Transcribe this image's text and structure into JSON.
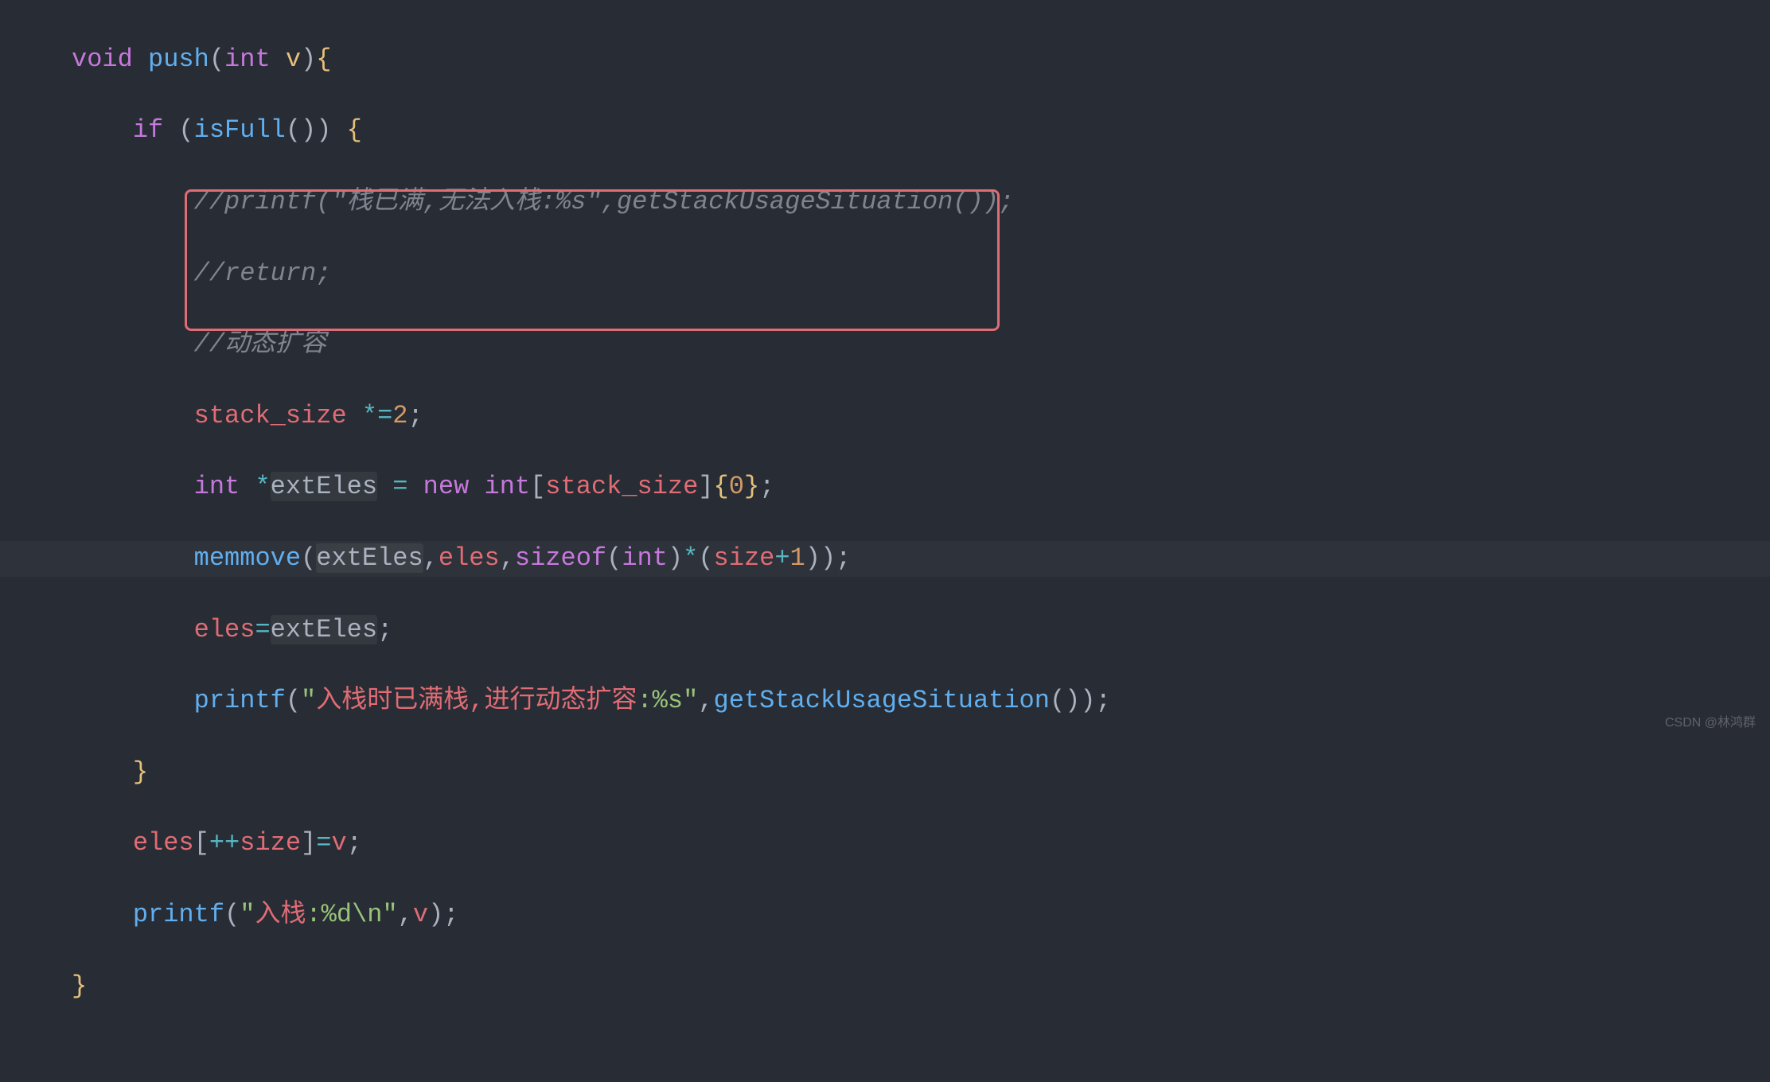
{
  "code": {
    "line1": {
      "kw_void": "void",
      "fn": "push",
      "paren_open": "(",
      "kw_int": "int",
      "param": "v",
      "paren_close": ")",
      "brace": "{"
    },
    "line2": {
      "kw_if": "if",
      "paren_open": "(",
      "fn": "isFull",
      "parens": "()",
      "paren_close": ")",
      "brace": "{"
    },
    "line3": {
      "comment": "//printf(\"栈已满,无法入栈:%s\",getStackUsageSituation());"
    },
    "line4": {
      "comment": "//return;"
    },
    "line5": {
      "comment": "//动态扩容"
    },
    "line6": {
      "ident": "stack_size",
      "op": "*=",
      "num": "2",
      "semi": ";"
    },
    "line7": {
      "kw_int": "int",
      "star": "*",
      "var": "extEles",
      "eq": "=",
      "kw_new": "new",
      "kw_int2": "int",
      "br_open": "[",
      "ident": "stack_size",
      "br_close": "]",
      "brace_open": "{",
      "num": "0",
      "brace_close": "}",
      "semi": ";"
    },
    "line8": {
      "fn": "memmove",
      "paren_open": "(",
      "arg1": "extEles",
      "comma1": ",",
      "arg2": "eles",
      "comma2": ",",
      "kw_sizeof": "sizeof",
      "paren_open2": "(",
      "kw_int": "int",
      "paren_close2": ")",
      "star": "*",
      "paren_open3": "(",
      "ident": "size",
      "plus": "+",
      "num": "1",
      "paren_close3": ")",
      "paren_close": ")",
      "semi": ";"
    },
    "line9": {
      "ident": "eles",
      "eq": "=",
      "var": "extEles",
      "semi": ";"
    },
    "line10": {
      "fn": "printf",
      "paren_open": "(",
      "quote1": "\"",
      "str_cn": "入栈时已满栈,进行动态扩容",
      "str_fmt": ":%s",
      "quote2": "\"",
      "comma": ",",
      "fn2": "getStackUsageSituation",
      "parens": "()",
      "paren_close": ")",
      "semi": ";"
    },
    "line11": {
      "brace": "}"
    },
    "line12": {
      "ident": "eles",
      "br_open": "[",
      "op": "++",
      "ident2": "size",
      "br_close": "]",
      "eq": "=",
      "ident3": "v",
      "semi": ";"
    },
    "line13": {
      "fn": "printf",
      "paren_open": "(",
      "quote1": "\"",
      "str_cn": "入栈",
      "str_fmt": ":%d\\n",
      "quote2": "\"",
      "comma": ",",
      "ident": "v",
      "paren_close": ")",
      "semi": ";"
    },
    "line14": {
      "brace": "}"
    }
  },
  "watermark": "CSDN @林鸿群"
}
